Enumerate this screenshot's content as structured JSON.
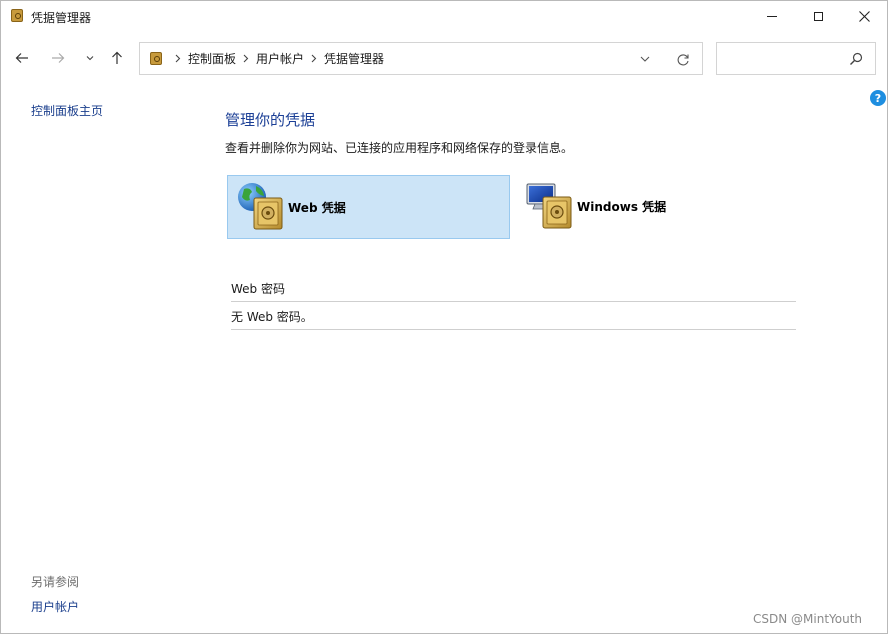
{
  "window": {
    "title": "凭据管理器",
    "icons": {
      "app": "credential-vault-icon",
      "minimize": "minimize-icon",
      "maximize": "maximize-icon",
      "close": "close-icon"
    }
  },
  "nav": {
    "icons": [
      "back-arrow-icon",
      "forward-arrow-icon",
      "chevron-down-icon",
      "up-arrow-icon"
    ],
    "breadcrumb": [
      "控制面板",
      "用户帐户",
      "凭据管理器"
    ],
    "search_placeholder": ""
  },
  "sidebar": {
    "home_link": "控制面板主页",
    "see_also_heading": "另请参阅",
    "links": [
      "用户帐户"
    ]
  },
  "main": {
    "heading": "管理你的凭据",
    "description": "查看并删除你为网站、已连接的应用程序和网络保存的登录信息。",
    "tiles": [
      {
        "label": "Web 凭据",
        "selected": true,
        "icon": "globe-vault-icon"
      },
      {
        "label": "Windows 凭据",
        "selected": false,
        "icon": "monitor-vault-icon"
      }
    ],
    "section_title": "Web 密码",
    "empty_message": "无 Web 密码。"
  },
  "help_glyph": "?",
  "watermark": "CSDN @MintYouth",
  "colors": {
    "link": "#1a3e8c",
    "heading": "#1b3f96",
    "selected_tile": "#cce4f7",
    "selected_border": "#99c9ef",
    "help": "#1e8ee0"
  }
}
